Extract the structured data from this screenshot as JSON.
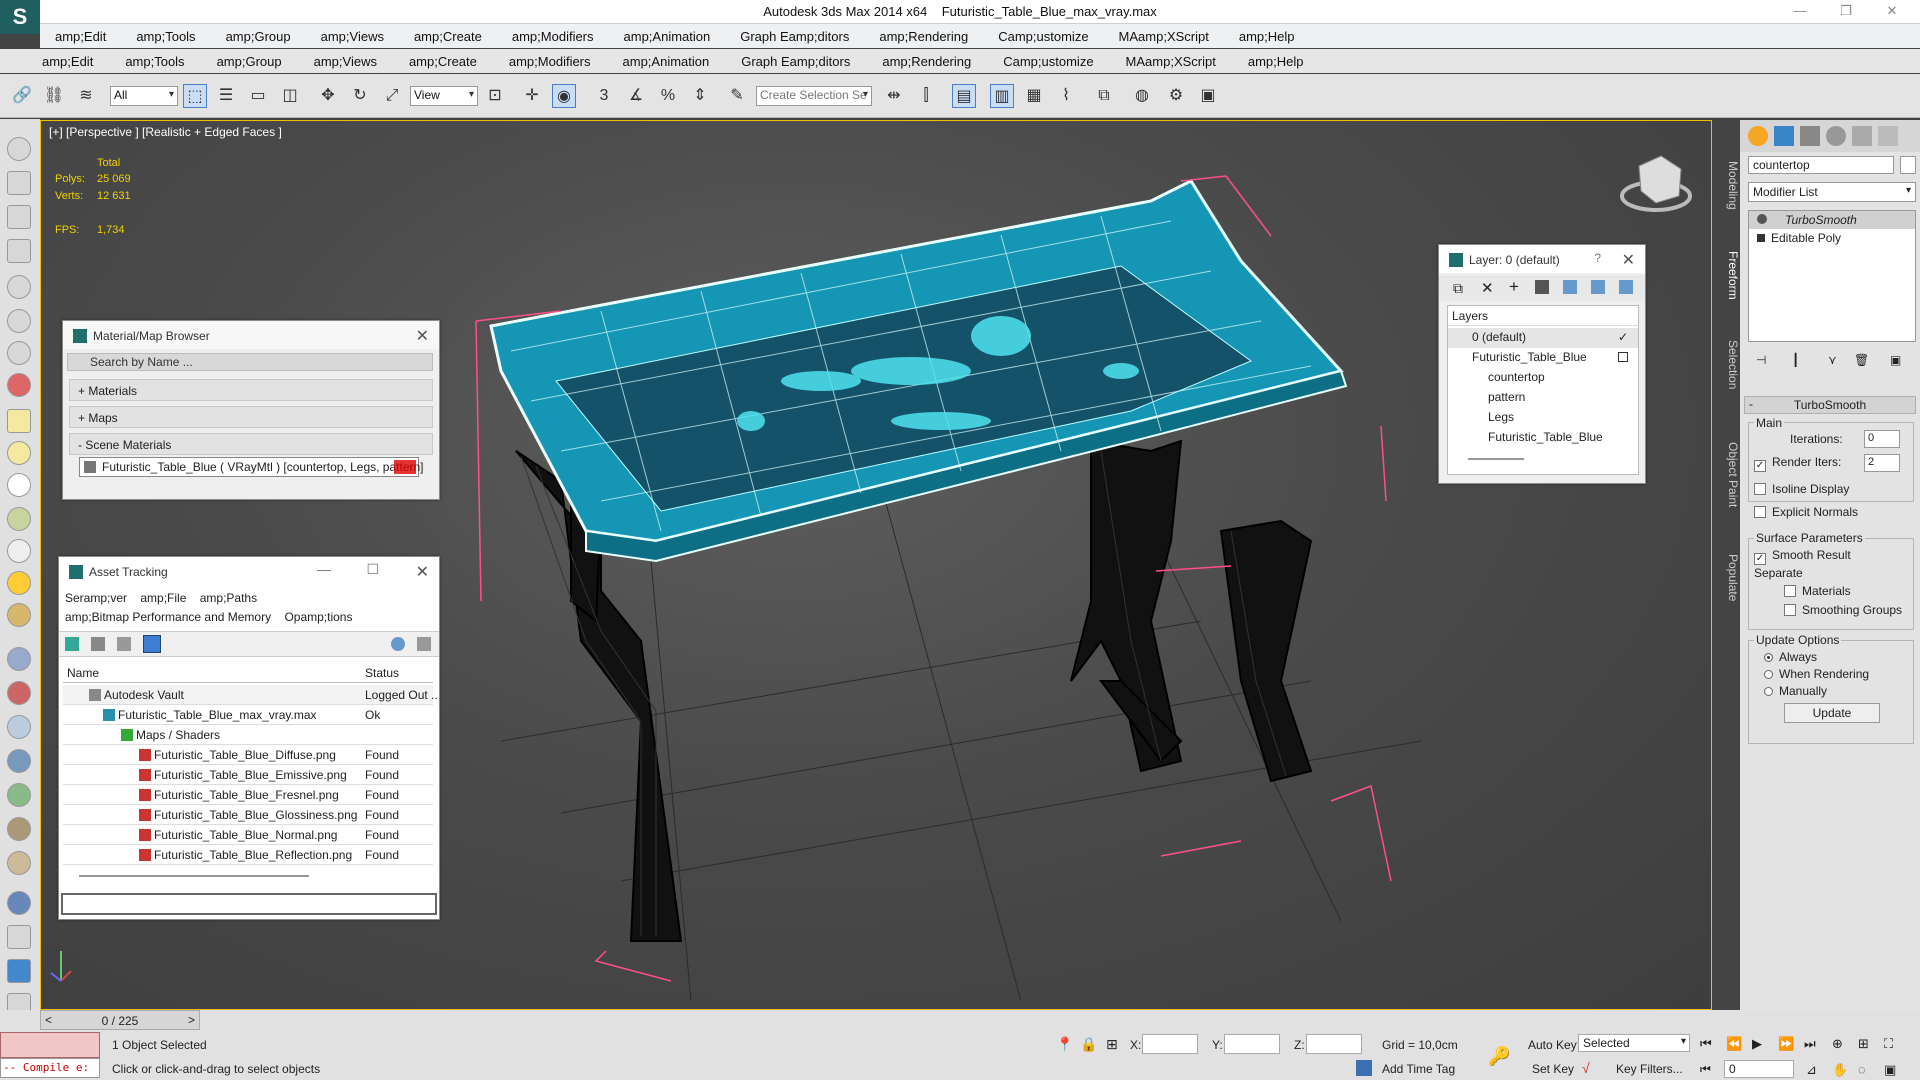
{
  "window": {
    "title_app": "Autodesk 3ds Max  2014 x64",
    "title_file": "Futuristic_Table_Blue_max_vray.max",
    "min_glyph": "—",
    "restore_glyph": "❐",
    "close_glyph": "✕",
    "logo_glyph": "S"
  },
  "menubar_top": [
    "amp;Edit",
    "amp;Tools",
    "amp;Group",
    "amp;Views",
    "amp;Create",
    "amp;Modifiers",
    "amp;Animation",
    "Graph Eamp;ditors",
    "amp;Rendering",
    "Camp;ustomize",
    "MAamp;XScript",
    "amp;Help"
  ],
  "menubar_main": [
    "amp;Edit",
    "amp;Tools",
    "amp;Group",
    "amp;Views",
    "amp;Create",
    "amp;Modifiers",
    "amp;Animation",
    "Graph Eamp;ditors",
    "amp;Rendering",
    "Camp;ustomize",
    "MAamp;XScript",
    "amp;Help"
  ],
  "toolbar": {
    "filter_value": "All",
    "refcoord_value": "View",
    "selection_set_placeholder": "Create Selection Se"
  },
  "viewport": {
    "label": "[+] [Perspective ] [Realistic + Edged Faces ]",
    "stats_header": "Total",
    "polys_label": "Polys:",
    "polys_value": "25 069",
    "verts_label": "Verts:",
    "verts_value": "12 631",
    "fps_label": "FPS:",
    "fps_value": "1,734"
  },
  "material_browser": {
    "title": "Material/Map Browser",
    "search_placeholder": "Search by Name ...",
    "sections": [
      "+ Materials",
      "+ Maps",
      "- Scene Materials"
    ],
    "item": "Futuristic_Table_Blue  ( VRayMtl )  [countertop, Legs, pattern]"
  },
  "asset_tracking": {
    "title": "Asset Tracking",
    "menu": [
      "Seramp;ver",
      "amp;File",
      "amp;Paths",
      "amp;Bitmap Performance and Memory",
      "Opamp;tions"
    ],
    "col_name": "Name",
    "col_status": "Status",
    "rows": [
      {
        "name": "Autodesk Vault",
        "status": "Logged Out .."
      },
      {
        "name": "Futuristic_Table_Blue_max_vray.max",
        "status": "Ok"
      },
      {
        "name": "Maps / Shaders",
        "status": ""
      },
      {
        "name": "Futuristic_Table_Blue_Diffuse.png",
        "status": "Found"
      },
      {
        "name": "Futuristic_Table_Blue_Emissive.png",
        "status": "Found"
      },
      {
        "name": "Futuristic_Table_Blue_Fresnel.png",
        "status": "Found"
      },
      {
        "name": "Futuristic_Table_Blue_Glossiness.png",
        "status": "Found"
      },
      {
        "name": "Futuristic_Table_Blue_Normal.png",
        "status": "Found"
      },
      {
        "name": "Futuristic_Table_Blue_Reflection.png",
        "status": "Found"
      }
    ]
  },
  "layers": {
    "title": "Layer: 0 (default)",
    "help": "?",
    "header": "Layers",
    "items": [
      {
        "name": "0 (default)"
      },
      {
        "name": "Futuristic_Table_Blue"
      },
      {
        "name": "countertop"
      },
      {
        "name": "pattern"
      },
      {
        "name": "Legs"
      },
      {
        "name": "Futuristic_Table_Blue"
      }
    ]
  },
  "command_panel": {
    "object_name": "countertop",
    "modifier_list": "Modifier List",
    "stack": [
      "TurboSmooth",
      "Editable Poly"
    ],
    "rollout_title": "TurboSmooth",
    "main_group": "Main",
    "iterations_label": "Iterations:",
    "iterations_value": "0",
    "render_iters_label": "Render Iters:",
    "render_iters_value": "2",
    "isoline": "Isoline Display",
    "explicit_normals": "Explicit Normals",
    "surface_group": "Surface Parameters",
    "smooth_result": "Smooth Result",
    "separate": "Separate",
    "materials": "Materials",
    "smoothing_groups": "Smoothing Groups",
    "update_group": "Update Options",
    "always": "Always",
    "when_rendering": "When Rendering",
    "manually": "Manually",
    "update_button": "Update"
  },
  "side_tabs": [
    "Modeling",
    "Freeform",
    "Selection",
    "Object Paint",
    "Populate"
  ],
  "status": {
    "maxscript": "-- Compile e:",
    "objects_selected": "1 Object Selected",
    "prompt": "Click or click-and-drag to select objects",
    "time_slider": "0 / 225",
    "x_label": "X:",
    "y_label": "Y:",
    "z_label": "Z:",
    "grid": "Grid = 10,0cm",
    "add_time_tag": "Add Time Tag",
    "auto_key": "Auto Key",
    "selected": "Selected",
    "set_key": "Set Key",
    "key_filters": "Key Filters...",
    "frame_value": "0"
  },
  "colors": {
    "table_glass": "#1aa7c2",
    "wire": "#e8ffff",
    "viewport_border": "#f0c000",
    "bbox": "#ff4f8a"
  }
}
